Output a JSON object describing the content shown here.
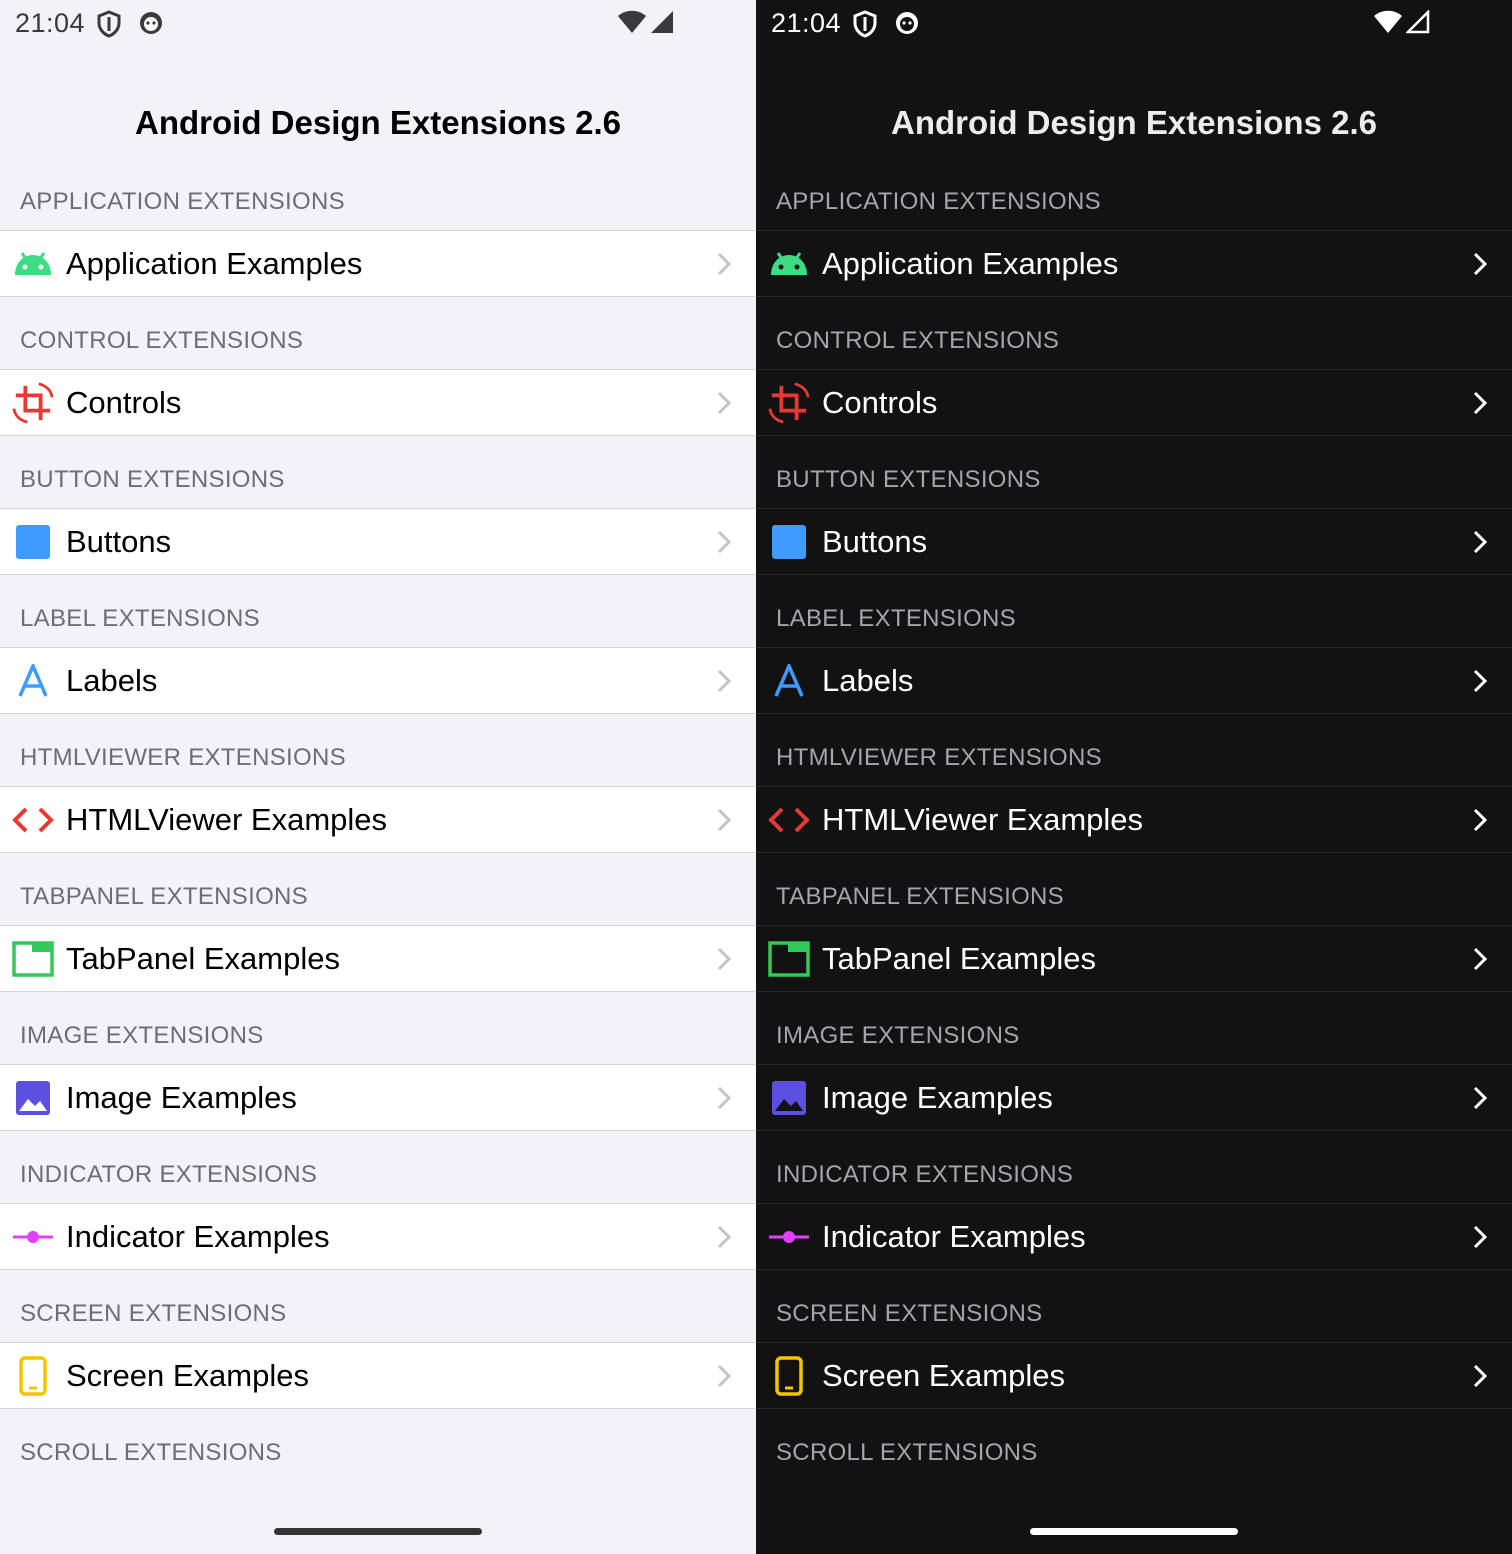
{
  "status": {
    "time": "21:04"
  },
  "title": "Android Design Extensions 2.6",
  "sections": [
    {
      "header": "APPLICATION EXTENSIONS",
      "item": "Application Examples",
      "icon": "android-icon",
      "color": "#3ddc84"
    },
    {
      "header": "CONTROL EXTENSIONS",
      "item": "Controls",
      "icon": "crop-rotate-icon",
      "color": "#e53935"
    },
    {
      "header": "BUTTON EXTENSIONS",
      "item": "Buttons",
      "icon": "square-icon",
      "color": "#3f9bff"
    },
    {
      "header": "LABEL EXTENSIONS",
      "item": "Labels",
      "icon": "letter-a-icon",
      "color": "#3f9bff"
    },
    {
      "header": "HTMLVIEWER EXTENSIONS",
      "item": "HTMLViewer Examples",
      "icon": "code-icon",
      "color": "#e53935"
    },
    {
      "header": "TABPANEL EXTENSIONS",
      "item": "TabPanel Examples",
      "icon": "tab-icon",
      "color": "#34c759"
    },
    {
      "header": "IMAGE EXTENSIONS",
      "item": "Image Examples",
      "icon": "image-icon",
      "color": "#5b50e0"
    },
    {
      "header": "INDICATOR EXTENSIONS",
      "item": "Indicator Examples",
      "icon": "indicator-icon",
      "color": "#e040fb"
    },
    {
      "header": "SCREEN EXTENSIONS",
      "item": "Screen Examples",
      "icon": "phone-icon",
      "color": "#f5c400"
    },
    {
      "header": "SCROLL EXTENSIONS"
    }
  ]
}
